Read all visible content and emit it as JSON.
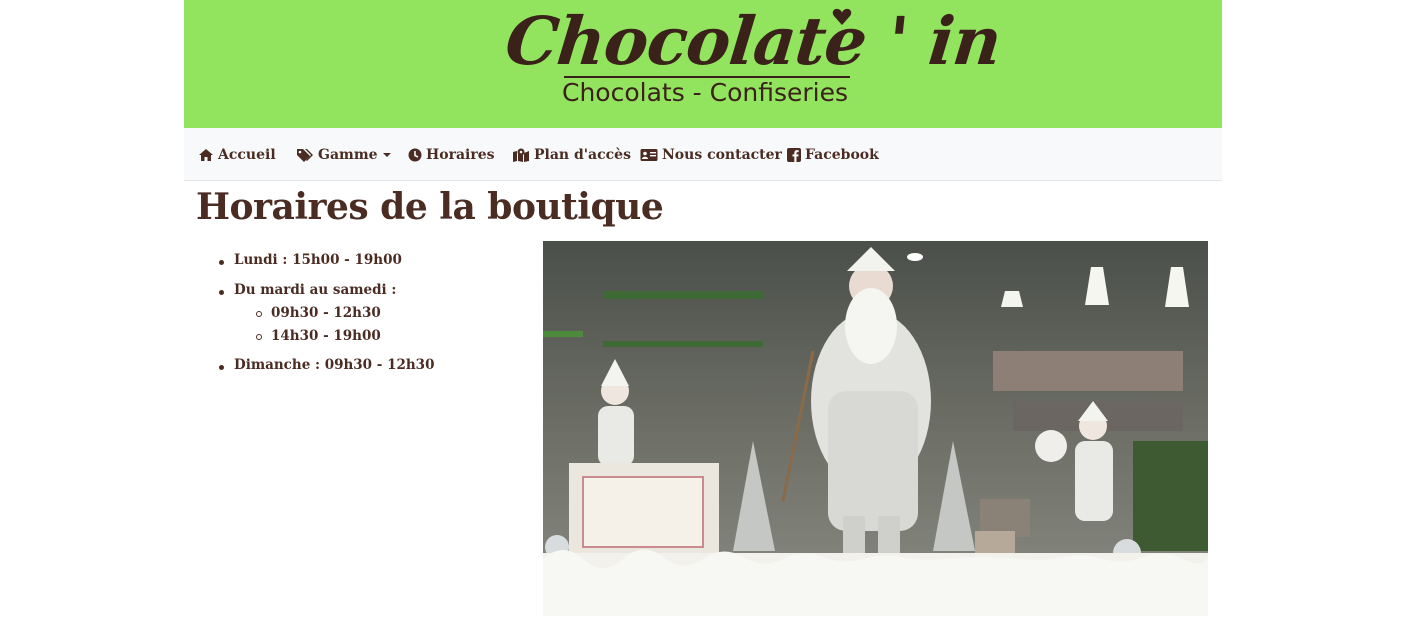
{
  "brand": {
    "name": "Chocolate ' in",
    "tagline": "Chocolats - Confiseries",
    "banner_color": "#92e45e",
    "text_color": "#3a211a"
  },
  "nav": {
    "items": [
      {
        "label": "Accueil",
        "icon": "home-icon"
      },
      {
        "label": "Gamme",
        "icon": "tags-icon",
        "dropdown": true
      },
      {
        "label": "Horaires",
        "icon": "clock-icon"
      },
      {
        "label": "Plan d'accès",
        "icon": "map-icon"
      },
      {
        "label": "Nous contacter",
        "icon": "address-card-icon"
      },
      {
        "label": "Facebook",
        "icon": "facebook-icon"
      }
    ]
  },
  "page": {
    "title": "Horaires de la boutique",
    "hours": {
      "monday": "Lundi : 15h00 - 19h00",
      "tue_sat": "Du mardi au samedi :",
      "tue_sat_slots": [
        "09h30 - 12h30",
        "14h30 - 19h00"
      ],
      "sunday": "Dimanche : 09h30 - 12h30"
    }
  },
  "colors": {
    "nav_background": "#f8f9fa",
    "text": "#4a2c22"
  }
}
